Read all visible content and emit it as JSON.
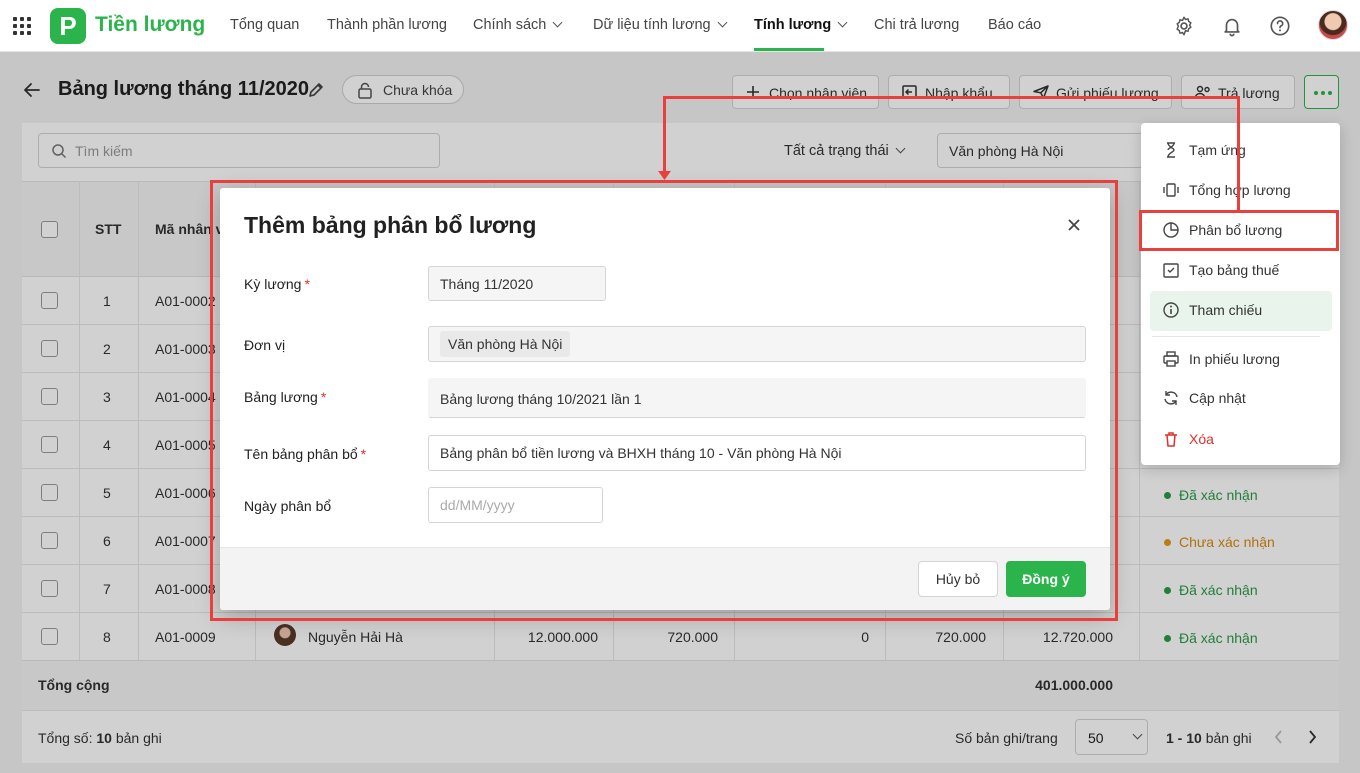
{
  "topnav": {
    "logo_letter": "P",
    "app_name": "Tiền lương",
    "items": [
      {
        "label": "Tổng quan"
      },
      {
        "label": "Thành phần lương"
      },
      {
        "label": "Chính sách"
      },
      {
        "label": "Dữ liệu tính lương"
      },
      {
        "label": "Tính lương"
      },
      {
        "label": "Chi trả lương"
      },
      {
        "label": "Báo cáo"
      }
    ],
    "active_item": "Tính lương",
    "icons": [
      "settings-icon",
      "bell-icon",
      "help-icon",
      "user-avatar"
    ]
  },
  "header": {
    "title": "Bảng lương tháng 11/2020",
    "lock_status": "Chưa khóa",
    "buttons": {
      "choose_employee": "Chọn nhân viên",
      "import": "Nhập khẩu",
      "send_payslip": "Gửi phiếu lương",
      "pay": "Trả lương"
    }
  },
  "toolbar": {
    "search_placeholder": "Tìm kiếm",
    "status_filter": "Tất cả trạng thái",
    "unit_filter": "Văn phòng Hà Nội"
  },
  "table": {
    "columns": {
      "stt": "STT",
      "employee_code": "Mã nhân v"
    },
    "rows": [
      {
        "stt": "1",
        "code": "A01-0002"
      },
      {
        "stt": "2",
        "code": "A01-0003"
      },
      {
        "stt": "3",
        "code": "A01-0004"
      },
      {
        "stt": "4",
        "code": "A01-0005"
      },
      {
        "stt": "5",
        "code": "A01-0006",
        "status": "Đã xác nhận"
      },
      {
        "stt": "6",
        "code": "A01-0007",
        "status": "Chưa xác nhận"
      },
      {
        "stt": "7",
        "code": "A01-0008",
        "status": "Đã xác nhận"
      },
      {
        "stt": "8",
        "code": "A01-0009",
        "name": "Nguyễn Hải Hà",
        "v1": "12.000.000",
        "v2": "720.000",
        "v3": "0",
        "v4": "720.000",
        "v5": "12.720.000",
        "status": "Đã xác nhận"
      }
    ],
    "total_label": "Tổng cộng",
    "total_value": "401.000.000"
  },
  "footer": {
    "total_prefix": "Tổng số:",
    "total_count": "10",
    "total_suffix": "bản ghi",
    "per_page_label": "Số bản ghi/trang",
    "per_page_value": "50",
    "range_bold": "1 - 10",
    "range_suffix": "bản ghi"
  },
  "dropdown": {
    "items": [
      {
        "label": "Tạm ứng",
        "icon": "advance-icon"
      },
      {
        "label": "Tổng hợp lương",
        "icon": "summary-icon"
      },
      {
        "label": "Phân bổ lương",
        "icon": "pie-chart-icon"
      },
      {
        "label": "Tạo bảng thuế",
        "icon": "tax-table-icon"
      },
      {
        "label": "Tham chiếu",
        "icon": "info-icon"
      },
      {
        "label": "In phiếu lương",
        "icon": "printer-icon"
      },
      {
        "label": "Cập nhật",
        "icon": "refresh-icon"
      },
      {
        "label": "Xóa",
        "icon": "trash-icon"
      }
    ]
  },
  "modal": {
    "title": "Thêm bảng phân bổ lương",
    "fields": {
      "period_label": "Kỳ lương",
      "period_value": "Tháng 11/2020",
      "unit_label": "Đơn vị",
      "unit_tag": "Văn phòng Hà Nội",
      "payroll_label": "Bảng lương",
      "payroll_value": "Bảng lương tháng 10/2021 lần 1",
      "name_label": "Tên bảng phân bổ",
      "name_value": "Bảng phân bổ tiền lương và BHXH tháng 10 - Văn phòng Hà Nội",
      "date_label": "Ngày phân bổ",
      "date_placeholder": "dd/MM/yyyy"
    },
    "cancel_label": "Hủy bỏ",
    "ok_label": "Đồng ý"
  },
  "colors": {
    "brand_green": "#2bb44b",
    "annotation_red": "#e8403c",
    "status_confirmed": "#2b9a46",
    "status_pending": "#d98a0e",
    "danger": "#e0312a"
  }
}
